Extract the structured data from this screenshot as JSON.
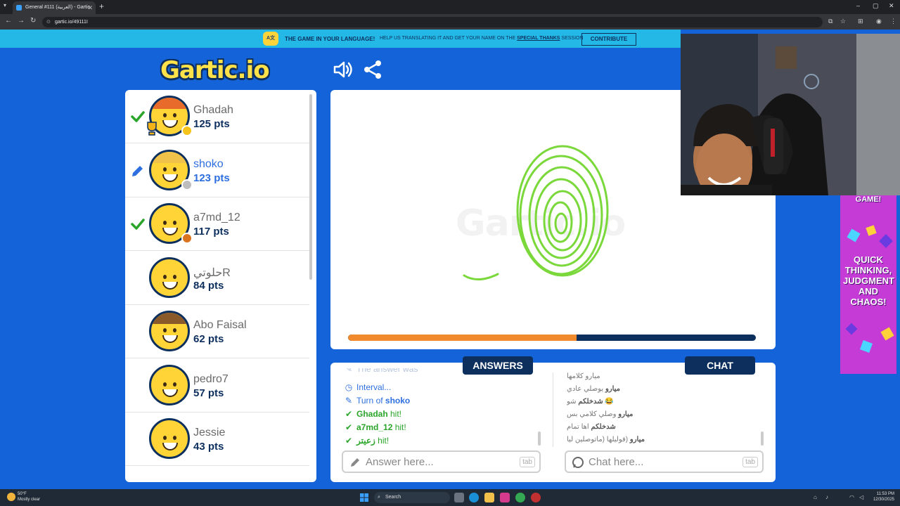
{
  "browser": {
    "tab_title": "General #111 (العربية) - Gartic",
    "new_tab": "+",
    "url": "gartic.io/49111I",
    "close": "✕",
    "minimize": "–",
    "maximize": "▢",
    "window_close": "✕"
  },
  "banner": {
    "badge": "A文",
    "headline": "THE GAME IN YOUR LANGUAGE!",
    "text_before": "HELP US TRANSLATING IT AND GET YOUR NAME ON THE ",
    "text_link": "SPECIAL THANKS",
    "text_after": " SESSION",
    "contribute_label": "CONTRIBUTE"
  },
  "logo": "Gartic.io",
  "watermark": "Gartic.io",
  "players": [
    {
      "name": "Ghadah",
      "points": "125 pts",
      "status": "guessed",
      "hair": "#e86b2b",
      "dot": "#f6c21c",
      "trophy": true
    },
    {
      "name": "shoko",
      "points": "123 pts",
      "status": "drawing",
      "hair": "#f0c24a",
      "dot": "#bdbdbd",
      "trophy": false
    },
    {
      "name": "a7md_12",
      "points": "117 pts",
      "status": "guessed",
      "hair": "",
      "dot": "#d9731e",
      "trophy": false
    },
    {
      "name": "حلوتيR",
      "points": "84 pts",
      "status": "none",
      "hair": "",
      "dot": "",
      "trophy": false
    },
    {
      "name": "Abo Faisal",
      "points": "62 pts",
      "status": "none",
      "hair": "#8a5a2b",
      "dot": "",
      "trophy": false
    },
    {
      "name": "pedro7",
      "points": "57 pts",
      "status": "none",
      "hair": "",
      "dot": "",
      "trophy": false
    },
    {
      "name": "Jessie",
      "points": "43 pts",
      "status": "none",
      "hair": "",
      "dot": "",
      "trophy": false
    }
  ],
  "timer": {
    "progress": 0.56,
    "fill_color": "#f08a2c",
    "track_color": "#0d2f5e"
  },
  "answers": {
    "title": "ANSWERS",
    "items": [
      {
        "type": "partial",
        "text": "The answer was",
        "name": ""
      },
      {
        "type": "interval",
        "text": "Interval...",
        "name": ""
      },
      {
        "type": "turn",
        "text": "Turn of ",
        "name": "shoko"
      },
      {
        "type": "hit",
        "text": " hit!",
        "name": "Ghadah"
      },
      {
        "type": "hit",
        "text": " hit!",
        "name": "a7md_12"
      },
      {
        "type": "hit",
        "text": " hit!",
        "name": "زعيتر"
      }
    ],
    "input_placeholder": "Answer here...",
    "tab_hint": "tab"
  },
  "chat": {
    "title": "CHAT",
    "messages": [
      {
        "user": "",
        "text": "ميارو كلامها"
      },
      {
        "user": "ميارو",
        "text": "يوصلي عادي"
      },
      {
        "user": "شدخلكم",
        "text": "شو 😂"
      },
      {
        "user": "ميارو",
        "text": "وصلي كلامي بس"
      },
      {
        "user": "شدخلكم",
        "text": "اها تمام"
      },
      {
        "user": "ميارو",
        "text": "(قوليلها (ماتوصلين ليا"
      }
    ],
    "input_placeholder": "Chat here...",
    "tab_hint": "tab"
  },
  "ad": {
    "top_text": "GAME!",
    "body_text": "QUICK THINKING, JUDGMENT AND CHAOS!"
  },
  "taskbar": {
    "weather_temp": "50°F",
    "weather_desc": "Mostly clear",
    "search_label": "Search",
    "time": "11:53 PM",
    "date": "12/30/2025"
  },
  "colors": {
    "page_bg": "#1463d8",
    "brand_navy": "#0d2f5e",
    "hit_green": "#2aa52a",
    "turn_blue": "#2e6fe0",
    "drawing_green": "#7ad83a"
  }
}
